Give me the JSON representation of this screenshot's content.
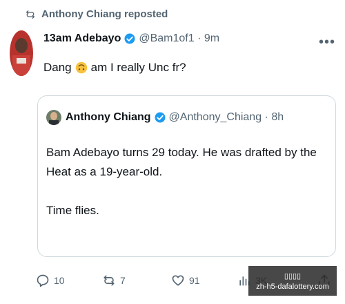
{
  "repost": {
    "label": "Anthony Chiang reposted"
  },
  "tweet": {
    "author_name": "13am Adebayo",
    "handle": "@Bam1of1",
    "time": "9m",
    "text_before": "Dang",
    "text_after": "am I really Unc fr?"
  },
  "quote": {
    "author_name": "Anthony Chiang",
    "handle": "@Anthony_Chiang",
    "time": "8h",
    "line1": "Bam Adebayo turns 29 today. He was drafted by the Heat as a 19-year-old.",
    "line2": "Time flies."
  },
  "actions": {
    "replies": "10",
    "reposts": "7",
    "likes": "91",
    "views": "3K"
  },
  "watermark": {
    "line1": "▯▯▯▯",
    "line2": "zh-h5-dafalottery.com"
  },
  "colors": {
    "accent": "#1d9bf0",
    "muted": "#536471",
    "text": "#0f1419"
  }
}
